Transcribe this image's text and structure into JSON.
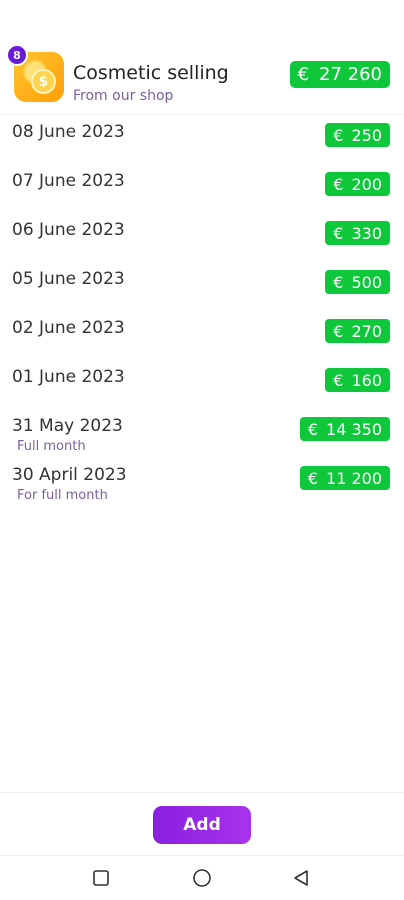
{
  "header": {
    "badge_count": "8",
    "coin_symbol": "$",
    "title": "Cosmetic selling",
    "subtitle": "From our shop",
    "total": {
      "currency": "€",
      "amount": "27 260"
    }
  },
  "entries": [
    {
      "date": "08 June 2023",
      "note": "",
      "currency": "€",
      "amount": "250"
    },
    {
      "date": "07 June 2023",
      "note": "",
      "currency": "€",
      "amount": "200"
    },
    {
      "date": "06 June 2023",
      "note": "",
      "currency": "€",
      "amount": "330"
    },
    {
      "date": "05 June 2023",
      "note": "",
      "currency": "€",
      "amount": "500"
    },
    {
      "date": "02 June 2023",
      "note": "",
      "currency": "€",
      "amount": "270"
    },
    {
      "date": "01 June 2023",
      "note": "",
      "currency": "€",
      "amount": "160"
    },
    {
      "date": "31 May 2023",
      "note": "Full month",
      "currency": "€",
      "amount": "14 350"
    },
    {
      "date": "30 April 2023",
      "note": "For full month",
      "currency": "€",
      "amount": "11 200"
    }
  ],
  "actions": {
    "add_label": "Add"
  },
  "colors": {
    "amount_green": "#0fc73a",
    "accent_purple": "#8a1fe0",
    "note_purple": "#7b5fa8",
    "icon_orange": "#ffb21e"
  },
  "navbar": {
    "icons": [
      "recent-apps-icon",
      "home-icon",
      "back-icon"
    ]
  }
}
